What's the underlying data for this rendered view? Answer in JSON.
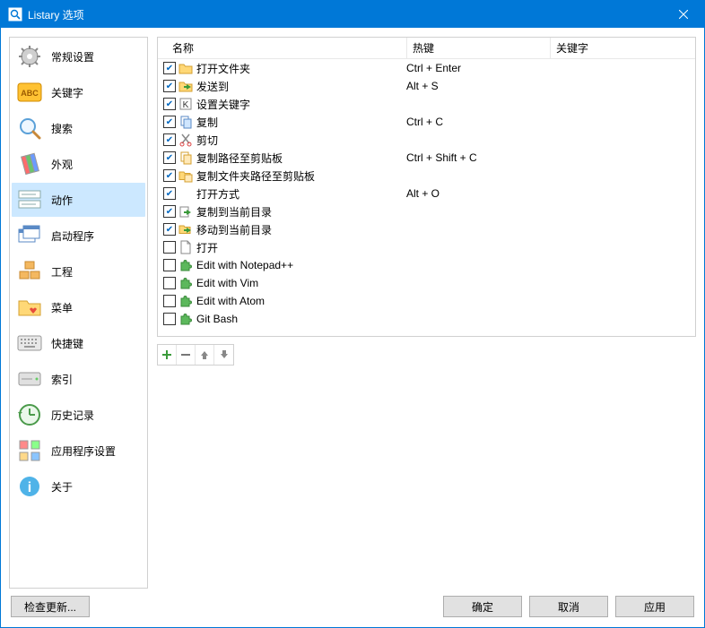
{
  "window": {
    "title": "Listary 选项"
  },
  "sidebar": {
    "items": [
      {
        "label": "常规设置"
      },
      {
        "label": "关键字"
      },
      {
        "label": "搜索"
      },
      {
        "label": "外观"
      },
      {
        "label": "动作"
      },
      {
        "label": "启动程序"
      },
      {
        "label": "工程"
      },
      {
        "label": "菜单"
      },
      {
        "label": "快捷键"
      },
      {
        "label": "索引"
      },
      {
        "label": "历史记录"
      },
      {
        "label": "应用程序设置"
      },
      {
        "label": "关于"
      }
    ]
  },
  "columns": {
    "name": "名称",
    "hotkey": "热键",
    "keyword": "关键字"
  },
  "actions": [
    {
      "checked": true,
      "icon": "folder",
      "name": "打开文件夹",
      "hotkey": "Ctrl + Enter"
    },
    {
      "checked": true,
      "icon": "send",
      "name": "发送到",
      "hotkey": "Alt + S"
    },
    {
      "checked": true,
      "icon": "key",
      "name": "设置关键字",
      "hotkey": ""
    },
    {
      "checked": true,
      "icon": "copy",
      "name": "复制",
      "hotkey": "Ctrl + C"
    },
    {
      "checked": true,
      "icon": "cut",
      "name": "剪切",
      "hotkey": ""
    },
    {
      "checked": true,
      "icon": "copypath",
      "name": "复制路径至剪贴板",
      "hotkey": "Ctrl + Shift + C"
    },
    {
      "checked": true,
      "icon": "copyfolder",
      "name": "复制文件夹路径至剪贴板",
      "hotkey": ""
    },
    {
      "checked": true,
      "icon": "none",
      "name": "打开方式",
      "hotkey": "Alt + O"
    },
    {
      "checked": true,
      "icon": "copyhere",
      "name": "复制到当前目录",
      "hotkey": ""
    },
    {
      "checked": true,
      "icon": "movehere",
      "name": "移动到当前目录",
      "hotkey": ""
    },
    {
      "checked": false,
      "icon": "page",
      "name": "打开",
      "hotkey": ""
    },
    {
      "checked": false,
      "icon": "puzzle",
      "name": "Edit with Notepad++",
      "hotkey": ""
    },
    {
      "checked": false,
      "icon": "puzzle",
      "name": "Edit with Vim",
      "hotkey": ""
    },
    {
      "checked": false,
      "icon": "puzzle",
      "name": "Edit with Atom",
      "hotkey": ""
    },
    {
      "checked": false,
      "icon": "puzzle",
      "name": "Git Bash",
      "hotkey": ""
    }
  ],
  "buttons": {
    "update": "检查更新...",
    "ok": "确定",
    "cancel": "取消",
    "apply": "应用"
  }
}
